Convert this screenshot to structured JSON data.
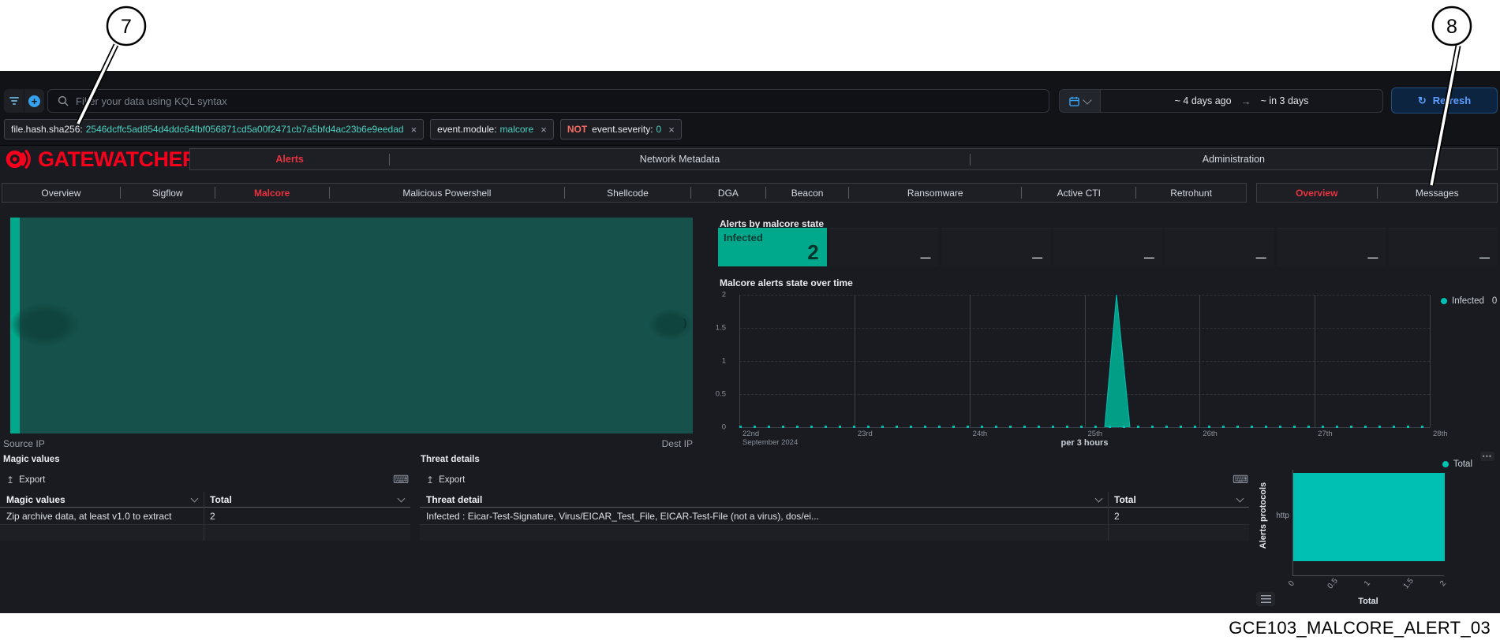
{
  "annotations": {
    "callout_left": "7",
    "callout_right": "8",
    "caption": "GCE103_MALCORE_ALERT_03"
  },
  "colors": {
    "teal": "#00bfb3",
    "teal_dark": "#00a98c",
    "sankey_flow": "#16514b",
    "brand_red": "#f7001c",
    "active_red": "#e8333f",
    "blue": "#36a2ef"
  },
  "icons": {
    "close": "×",
    "dash": "—",
    "dots_menu": "•••",
    "refresh": "↻",
    "export": "↥",
    "keyboard": "⌨",
    "range_arrow": "→",
    "plus": "+"
  },
  "topbar": {
    "search_placeholder": "Filter your data using KQL syntax",
    "date_from": "~ 4 days ago",
    "date_to": "~ in 3 days",
    "refresh_label": "Refresh"
  },
  "filters": [
    {
      "field": "file.hash.sha256:",
      "value": "2546dcffc5ad854d4ddc64fbf056871cd5a00f2471cb7a5bfd4ac23b6e9eedad"
    },
    {
      "field": "event.module:",
      "value": "malcore"
    },
    {
      "prefix": "NOT",
      "field": "event.severity:",
      "value": "0"
    }
  ],
  "brand": "GATEWATCHER",
  "main_nav": [
    {
      "label": "Alerts",
      "active": true
    },
    {
      "label": "Network Metadata",
      "active": false
    },
    {
      "label": "Administration",
      "active": false
    }
  ],
  "subtabs": {
    "left": [
      {
        "label": "Overview",
        "active": false
      },
      {
        "label": "Sigflow",
        "active": false
      },
      {
        "label": "Malcore",
        "active": true
      },
      {
        "label": "Malicious Powershell",
        "active": false
      },
      {
        "label": "Shellcode",
        "active": false
      },
      {
        "label": "DGA",
        "active": false
      },
      {
        "label": "Beacon",
        "active": false
      },
      {
        "label": "Ransomware",
        "active": false
      },
      {
        "label": "Active CTI",
        "active": false
      },
      {
        "label": "Retrohunt",
        "active": false
      }
    ],
    "right": [
      {
        "label": "Overview",
        "active": true
      },
      {
        "label": "Messages",
        "active": false
      }
    ]
  },
  "sankey": {
    "source_label": "Source IP",
    "dest_label": "Dest IP",
    "clipped_glyph": ")"
  },
  "state_cards": {
    "title": "Alerts by malcore state",
    "cards": [
      {
        "label": "Infected",
        "value": "2",
        "state": "infected"
      },
      {
        "value": "—"
      },
      {
        "value": "—"
      },
      {
        "value": "—"
      },
      {
        "value": "—"
      },
      {
        "value": "—"
      },
      {
        "value": "—"
      }
    ]
  },
  "time_chart": {
    "title": "Malcore alerts state over time",
    "y_ticks": [
      "2",
      "1.5",
      "1",
      "0.5",
      "0"
    ],
    "x_ticks": [
      "22nd",
      "23rd",
      "24th",
      "25th",
      "26th",
      "27th",
      "28th"
    ],
    "x_subtick": "September 2024",
    "x_axis_label": "per 3 hours",
    "legend": {
      "label": "Infected",
      "value": "0"
    }
  },
  "magic_panel": {
    "title": "Magic values",
    "export_label": "Export",
    "columns": [
      "Magic values",
      "Total"
    ],
    "rows": [
      [
        "Zip archive data, at least v1.0 to extract",
        "2"
      ]
    ]
  },
  "threat_panel": {
    "title": "Threat details",
    "export_label": "Export",
    "columns": [
      "Threat detail",
      "Total"
    ],
    "rows": [
      [
        "Infected : Eicar-Test-Signature, Virus/EICAR_Test_File, EICAR-Test-File (not a virus), dos/ei...",
        "2"
      ]
    ]
  },
  "protocol_chart": {
    "legend_label": "Total",
    "y_axis_label": "Alerts protocols",
    "categories": [
      "http"
    ],
    "x_ticks": [
      "0",
      "0.5",
      "1",
      "1.5",
      "2"
    ],
    "x_axis_label": "Total"
  },
  "chart_data": [
    {
      "type": "sankey",
      "nodes": [
        "Source IP",
        "Dest IP"
      ],
      "links": [
        {
          "source": "Source IP",
          "target": "Dest IP"
        }
      ]
    },
    {
      "type": "bar",
      "title": "Alerts by malcore state",
      "categories": [
        "Infected"
      ],
      "values": [
        2
      ],
      "note": "metric tiles; all other states empty (—)"
    },
    {
      "type": "area",
      "title": "Malcore alerts state over time",
      "series": [
        {
          "name": "Infected",
          "points": [
            [
              "2024-09-25T06:00",
              2
            ]
          ],
          "baseline": 0
        }
      ],
      "x_range": [
        "2024-09-22",
        "2024-09-29"
      ],
      "x_bucket": "per 3 hours",
      "ylim": [
        0,
        2
      ],
      "y_ticks": [
        0,
        0.5,
        1,
        1.5,
        2
      ],
      "legend": [
        {
          "name": "Infected",
          "current_value": 0
        }
      ],
      "grid": true
    },
    {
      "type": "bar",
      "orientation": "horizontal",
      "title": "Alerts protocols",
      "categories": [
        "http"
      ],
      "values": [
        2
      ],
      "xlabel": "Total",
      "ylabel": "Alerts protocols",
      "xlim": [
        0,
        2
      ],
      "legend_position": "top-right"
    }
  ]
}
